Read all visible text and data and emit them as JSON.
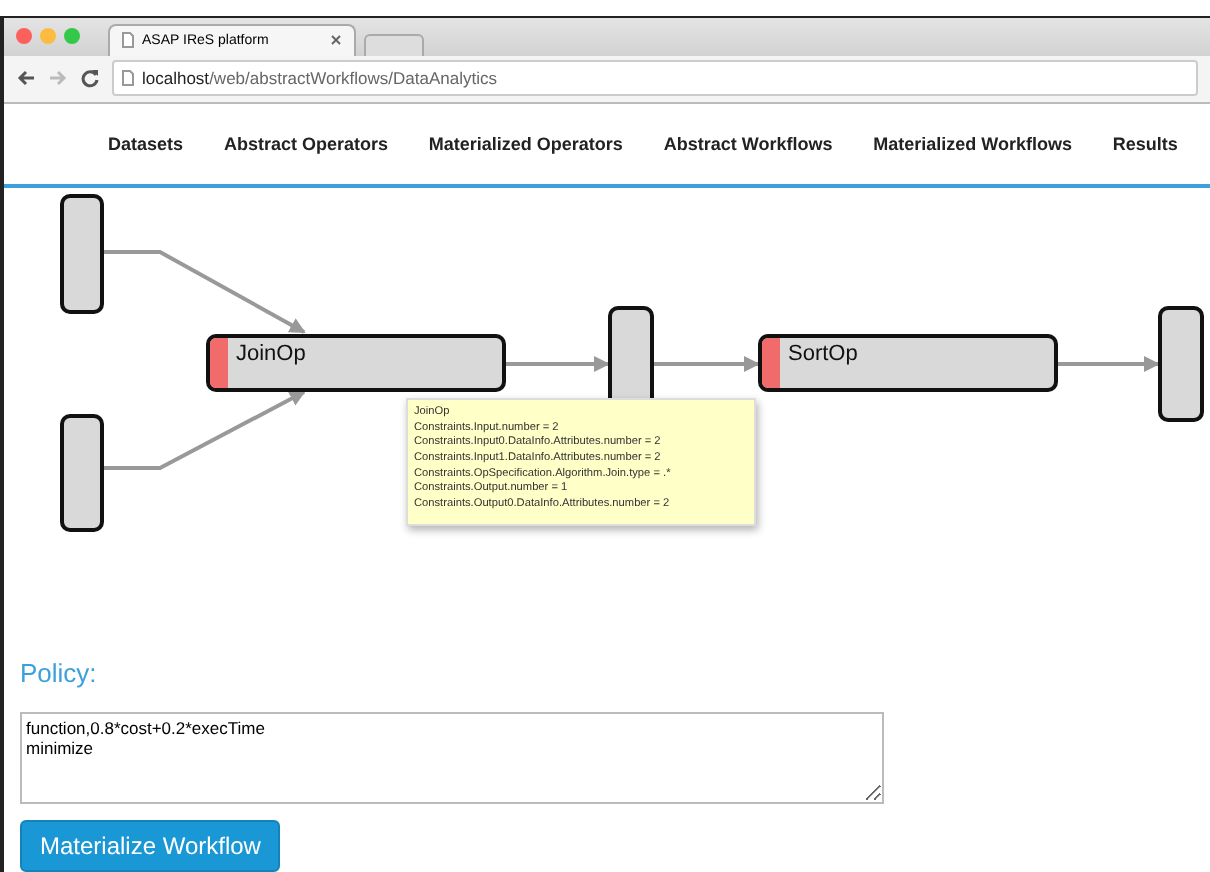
{
  "browser": {
    "tab_title": "ASAP IReS platform",
    "url_host": "localhost",
    "url_path": "/web/abstractWorkflows/DataAnalytics"
  },
  "nav": [
    "Datasets",
    "Abstract Operators",
    "Materialized Operators",
    "Abstract Workflows",
    "Materialized Workflows",
    "Results"
  ],
  "workflow": {
    "nodes": [
      {
        "kind": "data"
      },
      {
        "kind": "data"
      },
      {
        "kind": "operator",
        "label": "JoinOp"
      },
      {
        "kind": "data"
      },
      {
        "kind": "operator",
        "label": "SortOp"
      },
      {
        "kind": "data"
      }
    ],
    "tooltip": [
      "JoinOp",
      "Constraints.Input.number = 2",
      "Constraints.Input0.DataInfo.Attributes.number = 2",
      "Constraints.Input1.DataInfo.Attributes.number = 2",
      "Constraints.OpSpecification.Algorithm.Join.type = .*",
      "Constraints.Output.number = 1",
      "Constraints.Output0.DataInfo.Attributes.number = 2"
    ]
  },
  "policy": {
    "label": "Policy:",
    "value": "function,0.8*cost+0.2*execTime\nminimize"
  },
  "button": "Materialize Workflow"
}
